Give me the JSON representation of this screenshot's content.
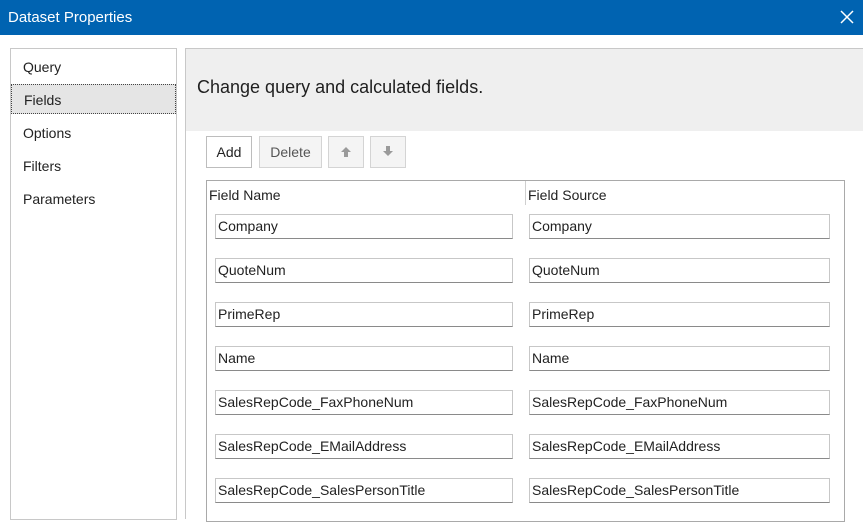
{
  "window": {
    "title": "Dataset Properties",
    "close_icon": "close-icon"
  },
  "sidebar": {
    "items": [
      {
        "label": "Query"
      },
      {
        "label": "Fields"
      },
      {
        "label": "Options"
      },
      {
        "label": "Filters"
      },
      {
        "label": "Parameters"
      }
    ],
    "selected": "Fields"
  },
  "main": {
    "subtitle": "Change query and calculated fields.",
    "toolbar": {
      "add_label": "Add",
      "delete_label": "Delete",
      "move_up_icon": "arrow-up-icon",
      "move_down_icon": "arrow-down-icon"
    },
    "grid": {
      "columns": [
        "Field Name",
        "Field Source"
      ],
      "rows": [
        {
          "name": "Company",
          "source": "Company"
        },
        {
          "name": "QuoteNum",
          "source": "QuoteNum"
        },
        {
          "name": "PrimeRep",
          "source": "PrimeRep"
        },
        {
          "name": "Name",
          "source": "Name"
        },
        {
          "name": "SalesRepCode_FaxPhoneNum",
          "source": "SalesRepCode_FaxPhoneNum"
        },
        {
          "name": "SalesRepCode_EMailAddress",
          "source": "SalesRepCode_EMailAddress"
        },
        {
          "name": "SalesRepCode_SalesPersonTitle",
          "source": "SalesRepCode_SalesPersonTitle"
        }
      ]
    }
  },
  "colors": {
    "titlebar": "#0063b1",
    "header_bg": "#efefef",
    "selected_bg": "#e5e5e5"
  }
}
